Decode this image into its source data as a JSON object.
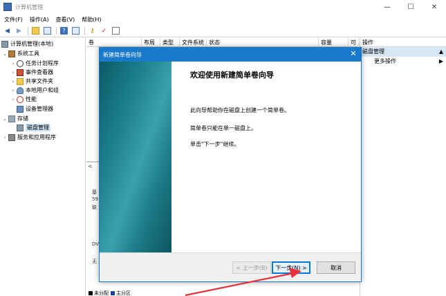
{
  "window": {
    "title": "计算机管理",
    "controls": [
      "—",
      "☐",
      "✕"
    ]
  },
  "menu": {
    "file": "文件(F)",
    "action": "操作(A)",
    "view": "查看(V)",
    "help": "帮助(H)"
  },
  "tree": {
    "root": "计算机管理(本地)",
    "system_tools": "系统工具",
    "task_scheduler": "任务计划程序",
    "event_viewer": "事件查看器",
    "shared_folders": "共享文件夹",
    "local_users": "本地用户和组",
    "performance": "性能",
    "device_manager": "设备管理器",
    "storage": "存储",
    "disk_management": "磁盘管理",
    "services_apps": "服务和应用程序"
  },
  "columns": {
    "volume": "卷",
    "layout": "布局",
    "type": "类型",
    "filesystem": "文件系统",
    "status": "状态",
    "capacity": "容量",
    "available": "可"
  },
  "middle": {
    "scroll_left": "<",
    "disk_label_1": "基",
    "disk_label_2": "59",
    "disk_label_3": "联",
    "dvd_label": "DV",
    "none_label": "无",
    "legend_unallocated": "未分配",
    "legend_primary": "主分区"
  },
  "actions": {
    "header": "操作",
    "section": "磁盘管理",
    "more": "更多操作"
  },
  "dialog": {
    "title": "新建简单卷向导",
    "heading": "欢迎使用新建简单卷向导",
    "p1": "此向导帮助你在磁盘上创建一个简单卷。",
    "p2": "简单卷只能在单一磁盘上。",
    "p3": "单击\"下一步\"继续。",
    "back_button": "< 上一步(B)",
    "next_button": "下一步(N) >",
    "cancel_button": "取消"
  },
  "colors": {
    "accent": "#1979ca",
    "annotation_arrow": "#e8303a"
  }
}
